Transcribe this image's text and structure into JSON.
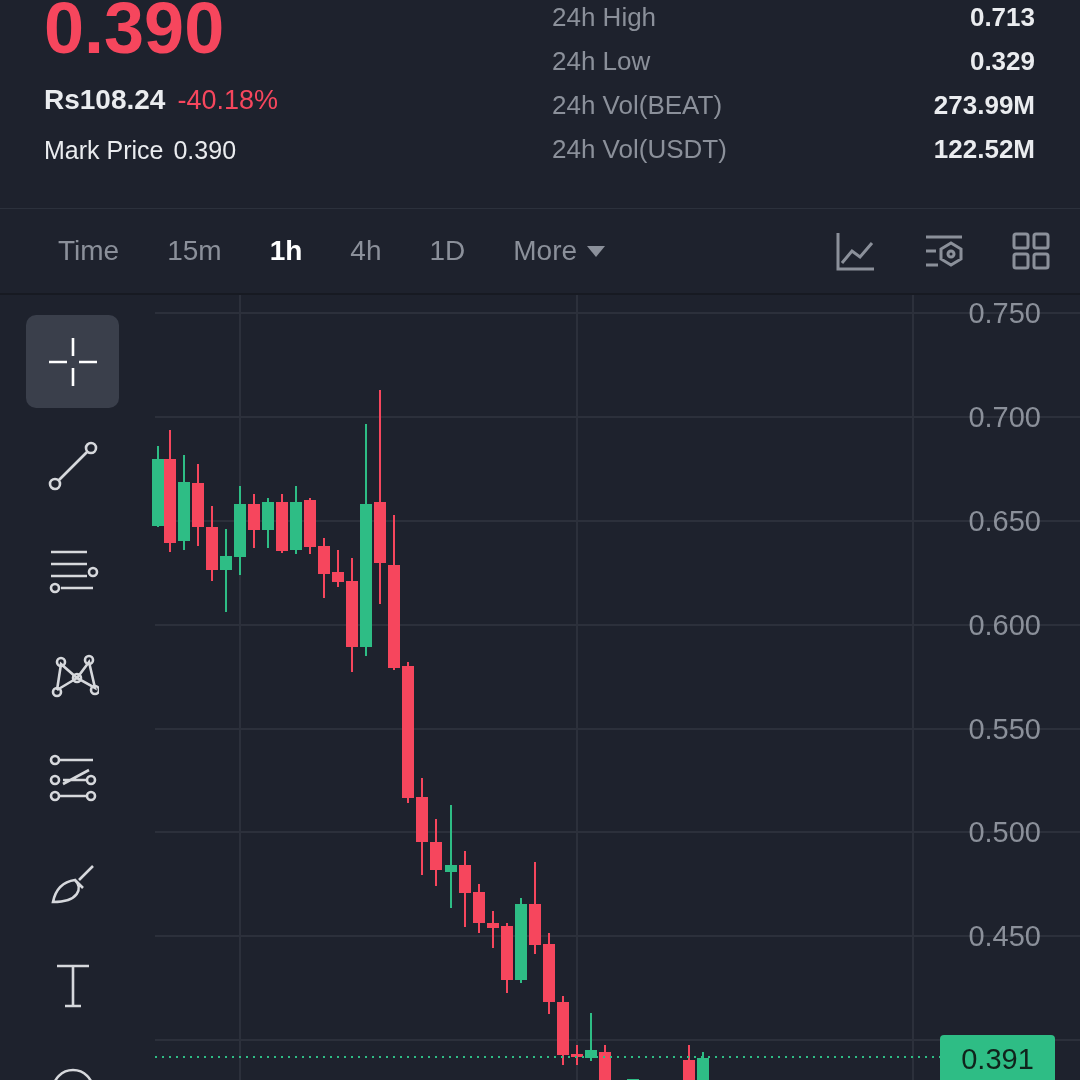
{
  "ticker": {
    "price": "0.390",
    "fiat_price": "Rs108.24",
    "change": "-40.18%",
    "mark_price_label": "Mark Price",
    "mark_price": "0.390"
  },
  "stats": [
    {
      "label": "24h High",
      "value": "0.713"
    },
    {
      "label": "24h Low",
      "value": "0.329"
    },
    {
      "label": "24h Vol(BEAT)",
      "value": "273.99M"
    },
    {
      "label": "24h Vol(USDT)",
      "value": "122.52M"
    }
  ],
  "intervals": [
    {
      "label": "Time",
      "kind": "tab",
      "selected": false
    },
    {
      "label": "15m",
      "kind": "tab",
      "selected": false
    },
    {
      "label": "1h",
      "kind": "tab",
      "selected": true
    },
    {
      "label": "4h",
      "kind": "tab",
      "selected": false
    },
    {
      "label": "1D",
      "kind": "tab",
      "selected": false
    },
    {
      "label": "More",
      "kind": "dropdown",
      "selected": false
    }
  ],
  "tools": [
    {
      "selected": true
    },
    {
      "selected": false
    },
    {
      "selected": false
    },
    {
      "selected": false
    },
    {
      "selected": false
    },
    {
      "selected": false
    },
    {
      "selected": false
    },
    {
      "selected": false
    }
  ],
  "chart": {
    "price_ticks": [
      "0.750",
      "0.700",
      "0.650",
      "0.600",
      "0.550",
      "0.500",
      "0.450"
    ],
    "last_price": "0.391"
  }
}
